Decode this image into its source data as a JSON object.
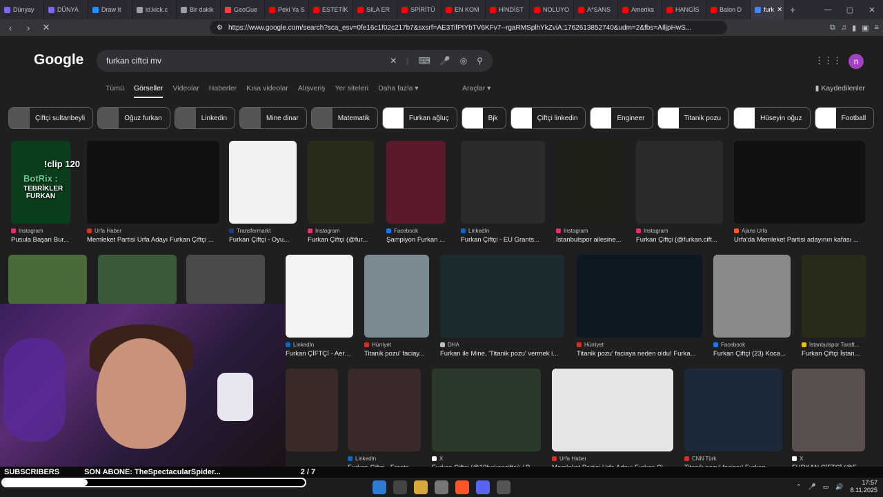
{
  "tabs": [
    {
      "label": "Dünyay",
      "color": "#7b68ee"
    },
    {
      "label": "DÜNYA",
      "color": "#7b68ee"
    },
    {
      "label": "Draw It",
      "color": "#1e90ff"
    },
    {
      "label": "id.kick.c",
      "color": "#9aa0a6"
    },
    {
      "label": "Bir dakik",
      "color": "#9aa0a6"
    },
    {
      "label": "GeoGue",
      "color": "#ff4040"
    },
    {
      "label": "Peki Ya S",
      "color": "#ff0000"
    },
    {
      "label": "ESTETİK",
      "color": "#ff0000"
    },
    {
      "label": "SILA ER",
      "color": "#ff0000"
    },
    {
      "label": "SPİRİTÜ",
      "color": "#ff0000"
    },
    {
      "label": "EN KOM",
      "color": "#ff0000"
    },
    {
      "label": "HİNDİST",
      "color": "#ff0000"
    },
    {
      "label": "NOLUYO",
      "color": "#ff0000"
    },
    {
      "label": "A*SANS",
      "color": "#ff0000"
    },
    {
      "label": "Amerika",
      "color": "#ff0000"
    },
    {
      "label": "HANGİS",
      "color": "#ff0000"
    },
    {
      "label": "Balon D",
      "color": "#ff0000"
    }
  ],
  "active_tab": {
    "label": "furk",
    "color": "#4285f4"
  },
  "url": "https://www.google.com/search?sca_esv=0fe16c1f02c217b7&sxsrf=AE3TifPtYbTV6KFv7--rgaRMSplhYkZviA:1762613852740&udm=2&fbs=AIljpHwS...",
  "logo": "Google",
  "query": "furkan ciftci mv",
  "avatar_letter": "n",
  "nav": [
    "Tümü",
    "Görseller",
    "Videolar",
    "Haberler",
    "Kısa videolar",
    "Alışveriş",
    "Yer siteleri",
    "Daha fazla ▾"
  ],
  "tools": "Araçlar ▾",
  "saved": "Kaydedilenler",
  "chips": [
    {
      "label": "Çiftçi sultanbeyli",
      "thumb": "img"
    },
    {
      "label": "Oğuz furkan",
      "thumb": "img"
    },
    {
      "label": "Linkedin",
      "thumb": "img"
    },
    {
      "label": "Mine dinar",
      "thumb": "img"
    },
    {
      "label": "Matematik",
      "thumb": "img"
    },
    {
      "label": "Furkan ağluç",
      "thumb": "white"
    },
    {
      "label": "Bjk",
      "thumb": "white"
    },
    {
      "label": "Çiftçi linkedin",
      "thumb": "white"
    },
    {
      "label": "Engineer",
      "thumb": "white"
    },
    {
      "label": "Titanik pozu",
      "thumb": "white"
    },
    {
      "label": "Hüseyin oğuz",
      "thumb": "white"
    },
    {
      "label": "Football",
      "thumb": "white"
    }
  ],
  "results_row1": [
    {
      "source": "Instagram",
      "title": "Pusula Başarı Bur...",
      "src_color": "#e1306c",
      "bg": "#0a3d1a"
    },
    {
      "source": "Urfa Haber",
      "title": "Memleket Partisi Urfa Adayı Furkan Çiftçi ...",
      "src_color": "#d93025",
      "bg": "#101010"
    },
    {
      "source": "Transfermarkt",
      "title": "Furkan Çiftçi - Oyu...",
      "src_color": "#1a3d7c",
      "bg": "#f2f2f2"
    },
    {
      "source": "Instagram",
      "title": "Furkan Çiftçi (@fur...",
      "src_color": "#e1306c",
      "bg": "#2a2a1a"
    },
    {
      "source": "Facebook",
      "title": "Şampiyon Furkan ...",
      "src_color": "#1877f2",
      "bg": "#5a1a2a"
    },
    {
      "source": "LinkedIn",
      "title": "Furkan Çiftçi - EU Grants...",
      "src_color": "#0a66c2",
      "bg": "#2b2b2b"
    },
    {
      "source": "Instagram",
      "title": "İstanbulspor ailesine...",
      "src_color": "#e1306c",
      "bg": "#1f1f16"
    },
    {
      "source": "Instagram",
      "title": "Furkan Çiftçi (@furkan.cift...",
      "src_color": "#e1306c",
      "bg": "#2a2a2a"
    },
    {
      "source": "Ajans Urfa",
      "title": "Urfa'da Memleket Partisi adayının kafası ...",
      "src_color": "#ff5722",
      "bg": "#111"
    }
  ],
  "results_row2": [
    {
      "source": "LinkedIn",
      "title": "Furkan ÇİFTÇİ - Aeros...",
      "src_color": "#0a66c2",
      "bg": "#f4f4f4"
    },
    {
      "source": "Hürriyet",
      "title": "Titanik pozu' faciay...",
      "src_color": "#d93025",
      "bg": "#7a8a90"
    },
    {
      "source": "DHA",
      "title": "Furkan ile Mine, 'Titanik pozu' vermek i...",
      "src_color": "#c0c0c0",
      "bg": "#1b2b30"
    },
    {
      "source": "Hürriyet",
      "title": "Titanik pozu' faciaya neden oldu! Furka...",
      "src_color": "#d93025",
      "bg": "#0e1820"
    },
    {
      "source": "Facebook",
      "title": "Furkan Çiftçi (23) Koca...",
      "src_color": "#1877f2",
      "bg": "#8a8a8a"
    },
    {
      "source": "İstanbulspor Taraft...",
      "title": "Furkan Çiftçi İstan...",
      "src_color": "#e8c000",
      "bg": "#2a2a1a"
    }
  ],
  "results_row3": [
    {
      "source": "LinkedIn",
      "title": "Furkan Çiftçi - Fronte...",
      "src_color": "#0a66c2",
      "bg": "#3a2a2a"
    },
    {
      "source": "X",
      "title": "Furkan Çiftçi (@10furkanciftci) / P...",
      "src_color": "#ffffff",
      "bg": "#2a3a2a"
    },
    {
      "source": "Urfa Haber",
      "title": "Memleket Partisi Urfa Adayı Furkan Çi...",
      "src_color": "#d93025",
      "bg": "#e6e6e6"
    },
    {
      "source": "CNN Türk",
      "title": "Titanik pozu' faciası! Furkan ...",
      "src_color": "#d93025",
      "bg": "#1a2a3a"
    },
    {
      "source": "X",
      "title": "FURKAN ÇİFTÇİ (@F...",
      "src_color": "#ffffff",
      "bg": "#5a5050"
    }
  ],
  "stream_overlay": {
    "line1": "!clip 120",
    "line2": "BotRix :",
    "line3": "TEBRİKLER FURKAN"
  },
  "ticker": {
    "left": "SUBSCRIBERS",
    "middle": "SON ABONE: TheSpectacularSpider...",
    "right": "2 / 7"
  },
  "progress_fraction": 0.28,
  "clock": {
    "time": "17:57",
    "date": "8.11.2025"
  }
}
